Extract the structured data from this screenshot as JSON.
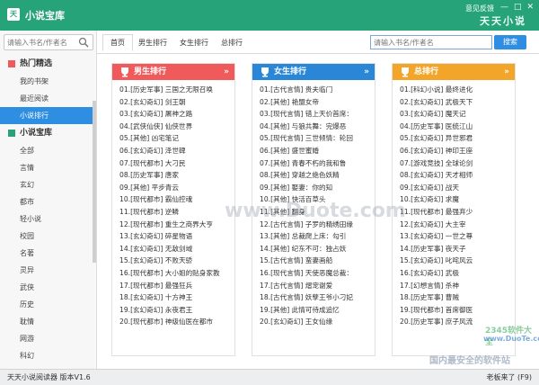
{
  "window": {
    "app_logo_text": "天",
    "title": "小说宝库",
    "feedback": "意见反馈",
    "slogan": "天天小说",
    "min_glyph": "—",
    "max_glyph": "□",
    "close_glyph": "✕"
  },
  "sidebar": {
    "search_placeholder": "请输入书名/作者名",
    "group_hot": "热门精选",
    "hot_items": [
      "我的书架",
      "最近阅读",
      "小说排行"
    ],
    "group_lib": "小说宝库",
    "lib_items": [
      "全部",
      "言情",
      "玄幻",
      "都市",
      "轻小说",
      "校园",
      "名著",
      "灵异",
      "武侠",
      "历史",
      "耽情",
      "网游",
      "科幻"
    ]
  },
  "tabs": [
    "首页",
    "男生排行",
    "女生排行",
    "总排行"
  ],
  "main_search": {
    "placeholder": "请输入书名/作者名",
    "button": "搜索"
  },
  "rankings": [
    {
      "title": "男生排行",
      "color": "#f05a5a",
      "more": "»",
      "items": [
        "01.[历史军事] 三国之无限召唤",
        "02.[玄幻奇幻] 剑王朝",
        "03.[玄幻奇幻] 屠神之路",
        "04.[武侠仙侠] 仙侠世界",
        "05.[其他] 凶宅笔记",
        "06.[玄幻奇幻] 泽世碑",
        "07.[现代都市] 大刁民",
        "08.[历史军事] 唐家",
        "09.[其他] 平步青云",
        "10.[现代都市] 霸仙控魂",
        "11.[现代都市] 逆鳞",
        "12.[现代都市] 重生之商界大亨",
        "13.[玄幻奇幻] 碎星物语",
        "14.[玄幻奇幻] 无敌剑域",
        "15.[玄幻奇幻] 不败天骄",
        "16.[现代都市] 大小姐的贴身家教",
        "17.[现代都市] 最强狂兵",
        "18.[玄幻奇幻] 十方神王",
        "19.[玄幻奇幻] 永夜君王",
        "20.[现代都市] 神级仙医在都市"
      ]
    },
    {
      "title": "女生排行",
      "color": "#2a87d8",
      "more": "»",
      "items": [
        "01.[古代言情] 贵夫临门",
        "02.[其他] 艳盟女帝",
        "03.[现代言情] 错上天价首席：",
        "04.[其他] 与狼共舞：完爆恶",
        "05.[现代言情] 三世倾情：轮回",
        "06.[其他] 盛世蜜婚",
        "07.[其他] 青春不朽的我和鲁",
        "08.[其他] 穿越之绝色妖精",
        "09.[其他] 娶妻：你的知",
        "10.[其他] 快活百草头",
        "11.[其他] 翻身",
        "12.[古代言情] 子罗的精绣田缘",
        "13.[其他] 总裁爬上床：勾引",
        "14.[其他] 纪东不可：独占妖",
        "15.[古代言情] 蛮妻画船",
        "16.[现代言情] 天使恶魔总裁：",
        "17.[古代言情] 熠宠谢爱",
        "18.[古代言情] 妖孽王爷小刁妃",
        "19.[其他] 此情可待成追忆",
        "20.[玄幻奇幻] 王女仙缘"
      ]
    },
    {
      "title": "总排行",
      "color": "#f3a52a",
      "more": "»",
      "items": [
        "01.[科幻小说] 最终进化",
        "02.[玄幻奇幻] 武极天下",
        "03.[玄幻奇幻] 魔天记",
        "04.[历史军事] 医统江山",
        "05.[玄幻奇幻] 异世邪君",
        "06.[玄幻奇幻] 神印王座",
        "07.[游戏竞技] 全球论剑",
        "08.[玄幻奇幻] 天才相师",
        "09.[玄幻奇幻] 战天",
        "10.[玄幻奇幻] 求魔",
        "11.[现代都市] 最强弃少",
        "12.[玄幻奇幻] 大主宰",
        "13.[玄幻奇幻] 一世之尊",
        "14.[历史军事] 夜天子",
        "15.[玄幻奇幻] 叱咤风云",
        "16.[玄幻奇幻] 武极",
        "17.[幻想言情] 杀神",
        "18.[历史军事] 曹贼",
        "19.[现代都市] 首席御医",
        "20.[历史军事] 庶子风流"
      ]
    }
  ],
  "status": {
    "left": "天天小说阅读器   版本V1.6",
    "right": "老板来了 (F9)"
  },
  "watermark": {
    "center": "www.Duote.com",
    "site": "2345软件大全",
    "site_url": "www.DuoTe.com",
    "security": "国内最安全的软件站"
  }
}
